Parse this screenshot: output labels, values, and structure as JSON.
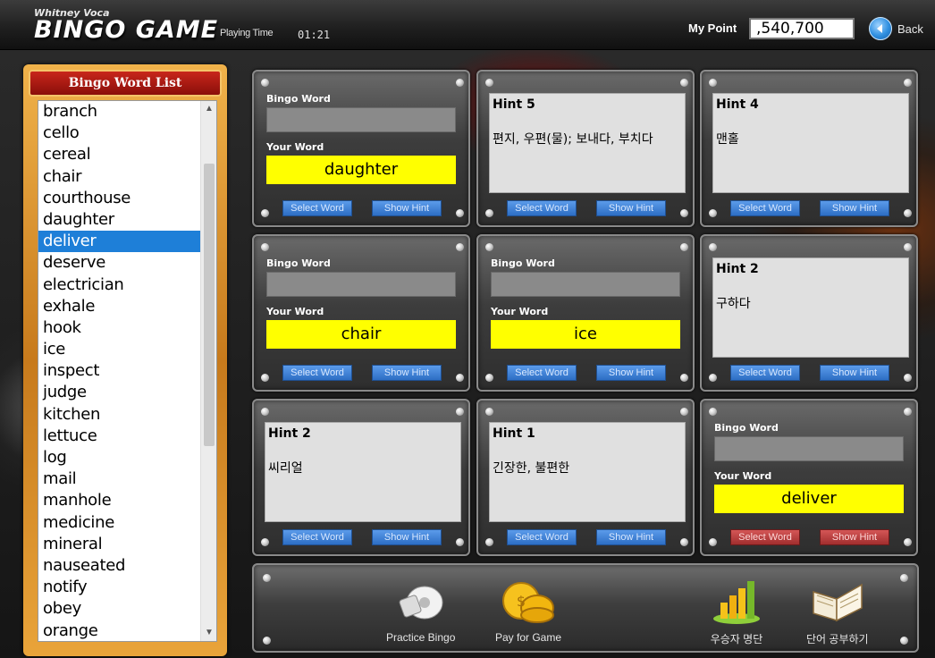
{
  "header": {
    "logo_top": "Whitney Voca",
    "logo_main": "BINGO GAME",
    "playing_time_label": "Playing Time",
    "playing_time_value": "01:21",
    "my_point_label": "My Point",
    "my_point_value": ",540,700",
    "back_label": "Back"
  },
  "wordlist": {
    "title": "Bingo Word List",
    "selected": "deliver",
    "items": [
      "branch",
      "cello",
      "cereal",
      "chair",
      "courthouse",
      "daughter",
      "deliver",
      "deserve",
      "electrician",
      "exhale",
      "hook",
      "ice",
      "inspect",
      "judge",
      "kitchen",
      "lettuce",
      "log",
      "mail",
      "manhole",
      "medicine",
      "mineral",
      "nauseated",
      "notify",
      "obey",
      "orange"
    ]
  },
  "cards": [
    {
      "type": "word",
      "bingo_word_label": "Bingo Word",
      "your_word_label": "Your Word",
      "your_word": "daughter",
      "select_label": "Select Word",
      "hint_label": "Show Hint",
      "selected": false
    },
    {
      "type": "hint",
      "hint_title": "Hint 5",
      "hint_text": "편지, 우편(물); 보내다, 부치다",
      "select_label": "Select Word",
      "hint_label": "Show Hint",
      "selected": false
    },
    {
      "type": "hint",
      "hint_title": "Hint 4",
      "hint_text": "맨홀",
      "select_label": "Select Word",
      "hint_label": "Show Hint",
      "selected": false
    },
    {
      "type": "word",
      "bingo_word_label": "Bingo Word",
      "your_word_label": "Your Word",
      "your_word": "chair",
      "select_label": "Select Word",
      "hint_label": "Show Hint",
      "selected": false
    },
    {
      "type": "word",
      "bingo_word_label": "Bingo Word",
      "your_word_label": "Your Word",
      "your_word": "ice",
      "select_label": "Select Word",
      "hint_label": "Show Hint",
      "selected": false
    },
    {
      "type": "hint",
      "hint_title": "Hint 2",
      "hint_text": "구하다",
      "select_label": "Select Word",
      "hint_label": "Show Hint",
      "selected": false
    },
    {
      "type": "hint",
      "hint_title": "Hint 2",
      "hint_text": "씨리얼",
      "select_label": "Select Word",
      "hint_label": "Show Hint",
      "selected": false
    },
    {
      "type": "hint",
      "hint_title": "Hint 1",
      "hint_text": "긴장한, 불편한",
      "select_label": "Select Word",
      "hint_label": "Show Hint",
      "selected": false
    },
    {
      "type": "word",
      "bingo_word_label": "Bingo Word",
      "your_word_label": "Your Word",
      "your_word": "deliver",
      "select_label": "Select Word",
      "hint_label": "Show Hint",
      "selected": true
    }
  ],
  "bottom": {
    "practice_label": "Practice Bingo",
    "pay_label": "Pay for Game",
    "ranking_label": "우승자 명단",
    "study_label": "단어 공부하기"
  },
  "colors": {
    "accent_blue": "#2d6ec4",
    "accent_red": "#a12e2e",
    "your_word_yellow": "#ffff00",
    "selected_row": "#1e7fd8"
  }
}
